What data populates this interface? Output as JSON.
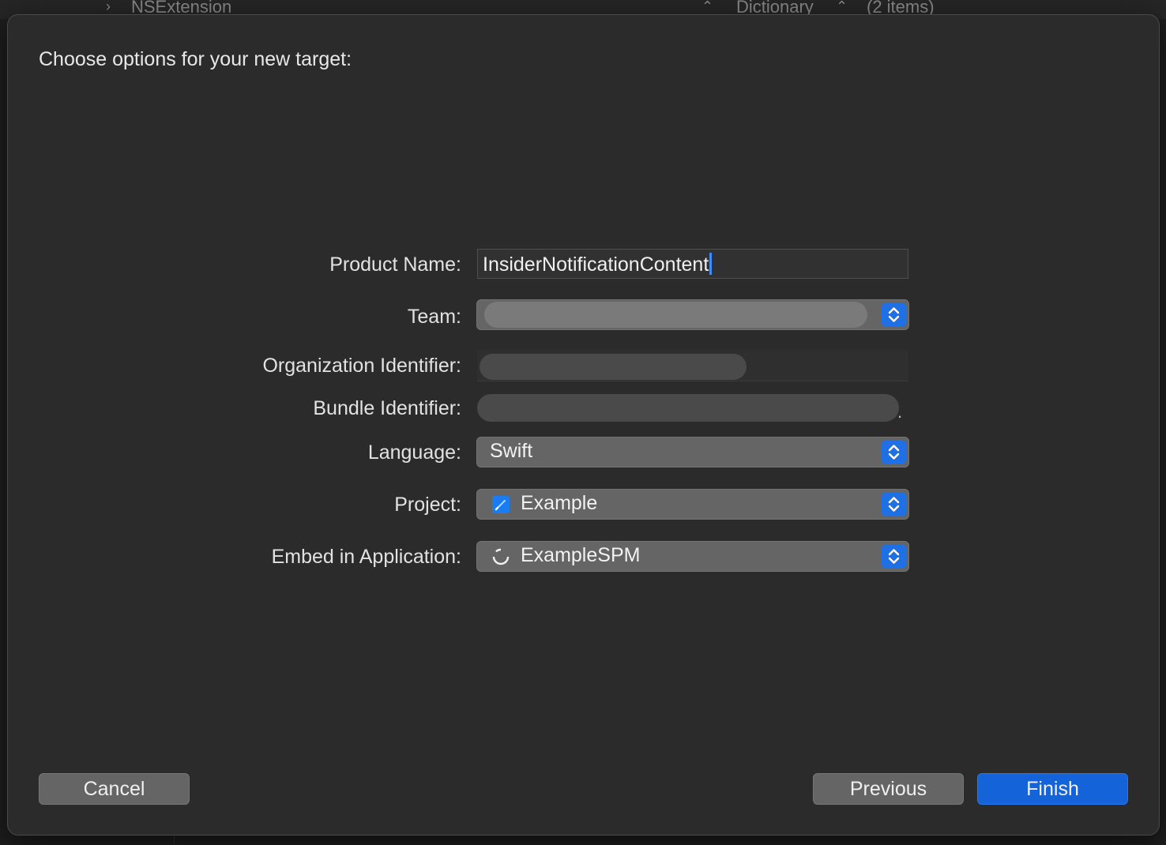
{
  "background": {
    "left_item": "NSExtension",
    "type_label": "Dictionary",
    "count_label": "(2 items)"
  },
  "sheet": {
    "title": "Choose options for your new target:"
  },
  "form": {
    "product_name": {
      "label": "Product Name:",
      "value": "InsiderNotificationContent"
    },
    "team": {
      "label": "Team:"
    },
    "organization_identifier": {
      "label": "Organization Identifier:"
    },
    "bundle_identifier": {
      "label": "Bundle Identifier:",
      "suffix": "."
    },
    "language": {
      "label": "Language:",
      "value": "Swift"
    },
    "project": {
      "label": "Project:",
      "value": "Example"
    },
    "embed_in_application": {
      "label": "Embed in Application:",
      "value": "ExampleSPM"
    }
  },
  "buttons": {
    "cancel": "Cancel",
    "previous": "Previous",
    "finish": "Finish"
  },
  "colors": {
    "accent": "#1f6fe5",
    "finish_button": "#1463d8",
    "sheet_background": "#2b2b2b"
  }
}
